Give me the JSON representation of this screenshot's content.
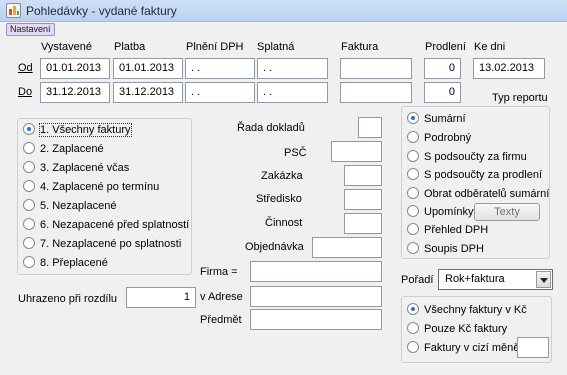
{
  "window": {
    "title": "Pohledávky - vydané faktury"
  },
  "menu": {
    "settings_label": "Nastavení"
  },
  "headers": {
    "vystavene": "Vystavené",
    "platba": "Platba",
    "plneni_dph": "Plnění DPH",
    "splatna": "Splatná",
    "faktura": "Faktura",
    "prodleni": "Prodlení",
    "ke_dni": "Ke dni"
  },
  "row_od": {
    "label": "Od",
    "vystavene": "01.01.2013",
    "platba": "01.01.2013",
    "plneni_dph": " .  .",
    "splatna": " .  .",
    "faktura": "",
    "prodleni": "0",
    "ke_dni": "13.02.2013"
  },
  "row_do": {
    "label": "Do",
    "vystavene": "31.12.2013",
    "platba": "31.12.2013",
    "plneni_dph": " .  .",
    "splatna": " .  .",
    "faktura": "",
    "prodleni": "0"
  },
  "invoice_filter": {
    "selected": 0,
    "options": [
      "1. Všechny faktury",
      "2. Zaplacené",
      "3. Zaplacené včas",
      "4. Zaplacené po termínu",
      "5. Nezaplacené",
      "6. Nezapacené před splatností",
      "7. Nezaplacené po splatnosti",
      "8. Přeplacené"
    ]
  },
  "mid_fields": {
    "rada_dokladu": {
      "label": "Řada dokladů",
      "value": ""
    },
    "psc": {
      "label": "PSČ",
      "value": ""
    },
    "zakazka": {
      "label": "Zakázka",
      "value": ""
    },
    "stredisko": {
      "label": "Středisko",
      "value": ""
    },
    "cinnost": {
      "label": "Činnost",
      "value": ""
    },
    "objednavka": {
      "label": "Objednávka",
      "value": ""
    },
    "firma": {
      "label": "Firma =",
      "value": ""
    },
    "adrese": {
      "label": "v Adrese",
      "value": ""
    },
    "predmet": {
      "label": "Předmět",
      "value": ""
    }
  },
  "uhrazeno": {
    "label": "Uhrazeno při rozdílu",
    "value": "1"
  },
  "report_type": {
    "title": "Typ reportu",
    "selected": 0,
    "options": [
      "Sumární",
      "Podrobný",
      "S podsoučty za firmu",
      "S podsoučty za prodlení",
      "Obrat odběratelů sumární",
      "Upomínky",
      "Přehled DPH",
      "Soupis DPH"
    ],
    "texty_button": "Texty"
  },
  "order": {
    "label": "Pořadí",
    "value": "Rok+faktura"
  },
  "currency": {
    "selected": 0,
    "options": [
      "Všechny faktury v Kč",
      "Pouze Kč faktury",
      "Faktury v cizí měně"
    ],
    "currency_code": ""
  },
  "colors": {
    "titlebar": "#cfe0f5",
    "radio_accent": "#2a6fd8",
    "settings_button": "#e4d9f2"
  }
}
